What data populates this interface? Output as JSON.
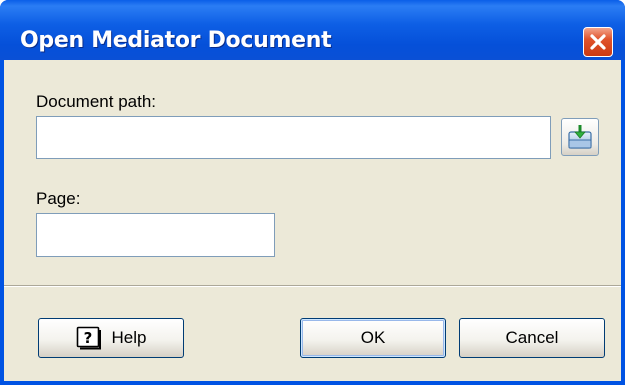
{
  "window": {
    "title": "Open Mediator Document",
    "close_symbol": "close-icon"
  },
  "form": {
    "document_path_label": "Document path:",
    "document_path_value": "",
    "page_label": "Page:",
    "page_value": ""
  },
  "buttons": {
    "help_label": "Help",
    "ok_label": "OK",
    "cancel_label": "Cancel"
  },
  "icons": {
    "browse": "open-folder-icon",
    "help": "help-book-icon"
  },
  "colors": {
    "titlebar": "#0053e3",
    "client": "#ece9d8",
    "close_button": "#e0532c",
    "input_border": "#7f9db9"
  }
}
